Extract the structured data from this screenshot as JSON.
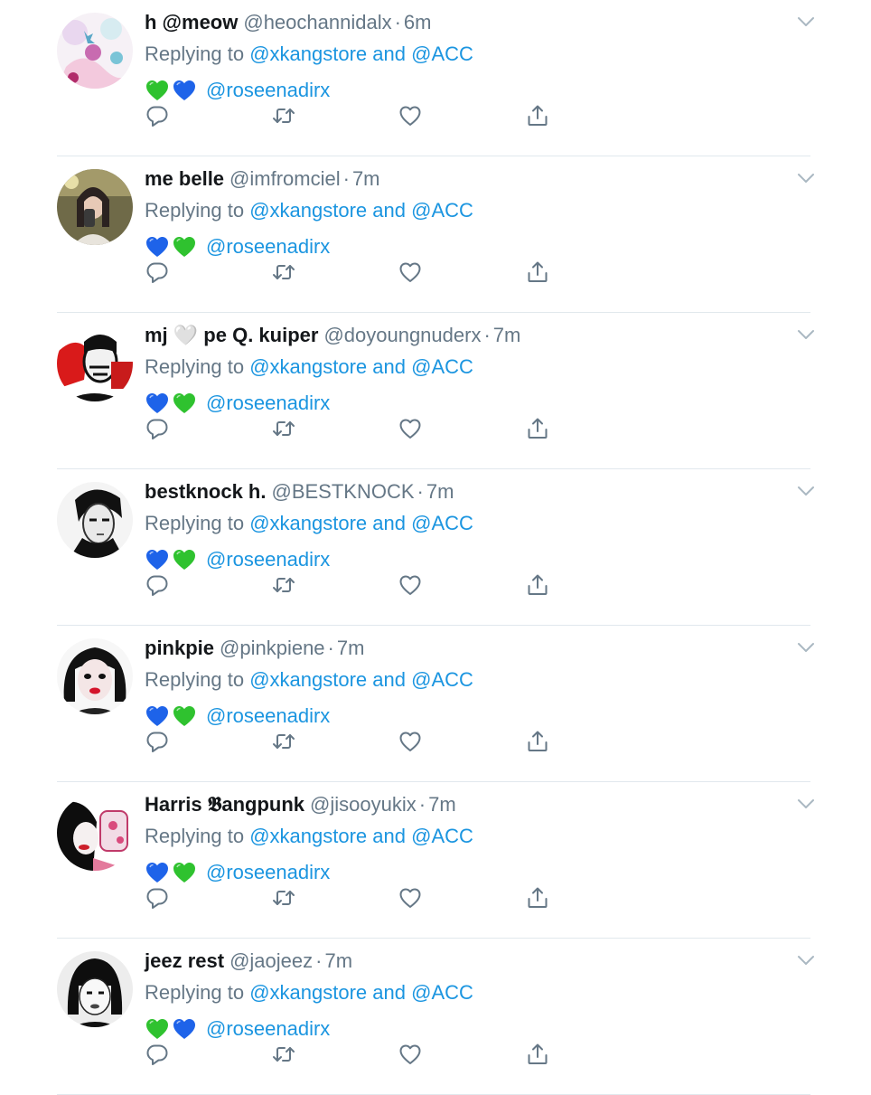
{
  "colors": {
    "name": "#14171a",
    "secondary": "#657786",
    "link": "#1b95e0",
    "divider": "#e1e8ed",
    "green_heart": "#2fc22f",
    "blue_heart": "#1e63e9"
  },
  "tweets": [
    {
      "name": "h @meow",
      "handle": "@heochannidalx",
      "dot": "·",
      "time": "6m",
      "replying_prefix": "Replying to",
      "reply_to_1": "@xkangstore",
      "reply_and": "and",
      "reply_to_2": "@ACC",
      "hearts": [
        "green-heart",
        "blue-heart"
      ],
      "mention": "@roseenadirx"
    },
    {
      "name": "me belle",
      "handle": "@imfromciel",
      "dot": "·",
      "time": "7m",
      "replying_prefix": "Replying to",
      "reply_to_1": "@xkangstore",
      "reply_and": "and",
      "reply_to_2": "@ACC",
      "hearts": [
        "blue-heart",
        "green-heart"
      ],
      "mention": "@roseenadirx"
    },
    {
      "name": "mj 🤍 pe Q. kuiper",
      "handle": "@doyoungnuderx",
      "dot": "·",
      "time": "7m",
      "replying_prefix": "Replying to",
      "reply_to_1": "@xkangstore",
      "reply_and": "and",
      "reply_to_2": "@ACC",
      "hearts": [
        "blue-heart",
        "green-heart"
      ],
      "mention": "@roseenadirx"
    },
    {
      "name": "bestknock h.",
      "handle": "@BESTKNOCK",
      "dot": "·",
      "time": "7m",
      "replying_prefix": "Replying to",
      "reply_to_1": "@xkangstore",
      "reply_and": "and",
      "reply_to_2": "@ACC",
      "hearts": [
        "blue-heart",
        "green-heart"
      ],
      "mention": "@roseenadirx"
    },
    {
      "name": "pinkpie",
      "handle": "@pinkpiene",
      "dot": "·",
      "time": "7m",
      "replying_prefix": "Replying to",
      "reply_to_1": "@xkangstore",
      "reply_and": "and",
      "reply_to_2": "@ACC",
      "hearts": [
        "blue-heart",
        "green-heart"
      ],
      "mention": "@roseenadirx"
    },
    {
      "name": "Harris 𝕭angpunk",
      "handle": "@jisooyukix",
      "dot": "·",
      "time": "7m",
      "replying_prefix": "Replying to",
      "reply_to_1": "@xkangstore",
      "reply_and": "and",
      "reply_to_2": "@ACC",
      "hearts": [
        "blue-heart",
        "green-heart"
      ],
      "mention": "@roseenadirx"
    },
    {
      "name": "jeez rest",
      "handle": "@jaojeez",
      "dot": "·",
      "time": "7m",
      "replying_prefix": "Replying to",
      "reply_to_1": "@xkangstore",
      "reply_and": "and",
      "reply_to_2": "@ACC",
      "hearts": [
        "green-heart",
        "blue-heart"
      ],
      "mention": "@roseenadirx"
    }
  ],
  "icons": {
    "reply": "reply-icon",
    "retweet": "retweet-icon",
    "like": "like-icon",
    "share": "share-icon",
    "caret": "chevron-down-icon"
  }
}
